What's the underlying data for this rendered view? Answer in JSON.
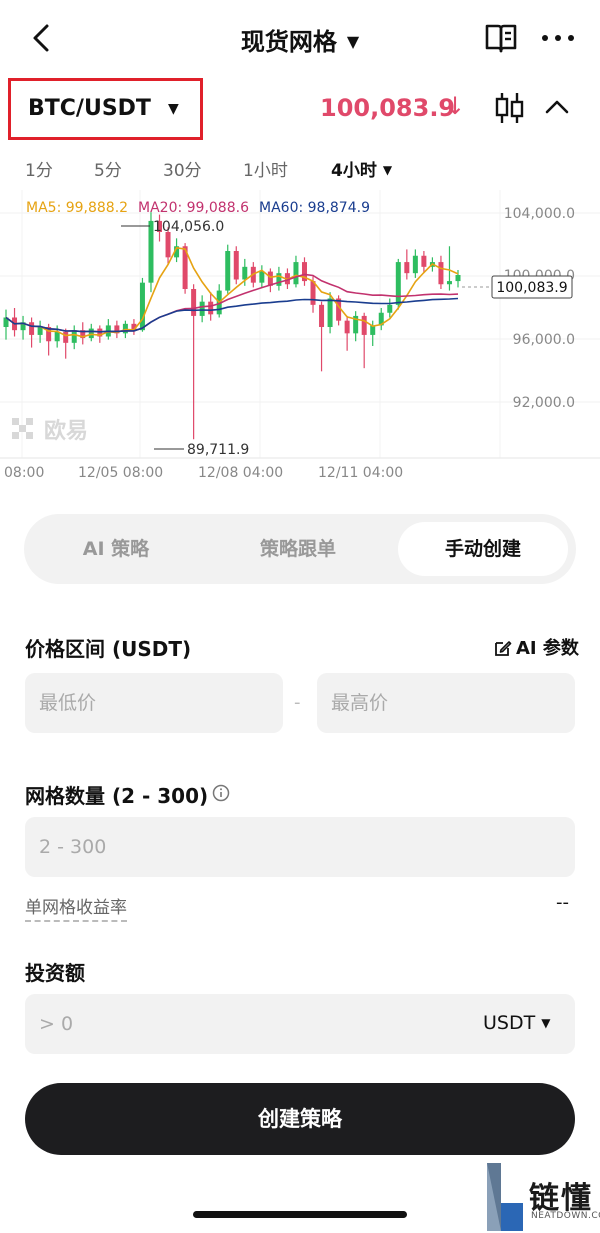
{
  "header": {
    "title": "现货网格",
    "back_icon": "chevron-left-icon",
    "book_icon": "book-icon",
    "more_icon": "more-dots-icon"
  },
  "pair": {
    "label": "BTC/USDT",
    "price": "100,083.9",
    "price_color": "#e0496a",
    "trend_icon": "arrow-down-icon"
  },
  "timeframes": [
    "1分",
    "5分",
    "30分",
    "1小时",
    "4小时"
  ],
  "active_timeframe": "4小时",
  "chart_data": {
    "type": "candlestick",
    "ma_labels": [
      {
        "label": "MA5: 99,888.2",
        "color": "#e6a313"
      },
      {
        "label": "MA20: 99,088.6",
        "color": "#c2326e"
      },
      {
        "label": "MA60: 98,874.9",
        "color": "#1a3d8f"
      }
    ],
    "y_ticks": [
      "104,000.0",
      "100,000.0",
      "96,000.0",
      "92,000.0"
    ],
    "x_ticks": [
      "08:00",
      "12/05 08:00",
      "12/08 04:00",
      "12/11 04:00"
    ],
    "high_label": "104,056.0",
    "low_label": "89,711.9",
    "last_price_label": "100,083.9",
    "up_color": "#2ebd60",
    "down_color": "#e0496a",
    "watermark": "欧易"
  },
  "tabs": [
    "AI 策略",
    "策略跟单",
    "手动创建"
  ],
  "active_tab": "手动创建",
  "form": {
    "price_range_label": "价格区间 (USDT)",
    "ai_param": "AI 参数",
    "min_placeholder": "最低价",
    "max_placeholder": "最高价",
    "dash": "-",
    "grid_count_label": "网格数量 (2 - 300)",
    "grid_count_placeholder": "2 - 300",
    "yield_label": "单网格收益率",
    "yield_value": "--",
    "invest_label": "投资额",
    "invest_placeholder": "> 0",
    "unit": "USDT",
    "submit": "创建策略"
  },
  "brand": {
    "name": "链懂",
    "sub": "NEATDOWN.COM"
  }
}
